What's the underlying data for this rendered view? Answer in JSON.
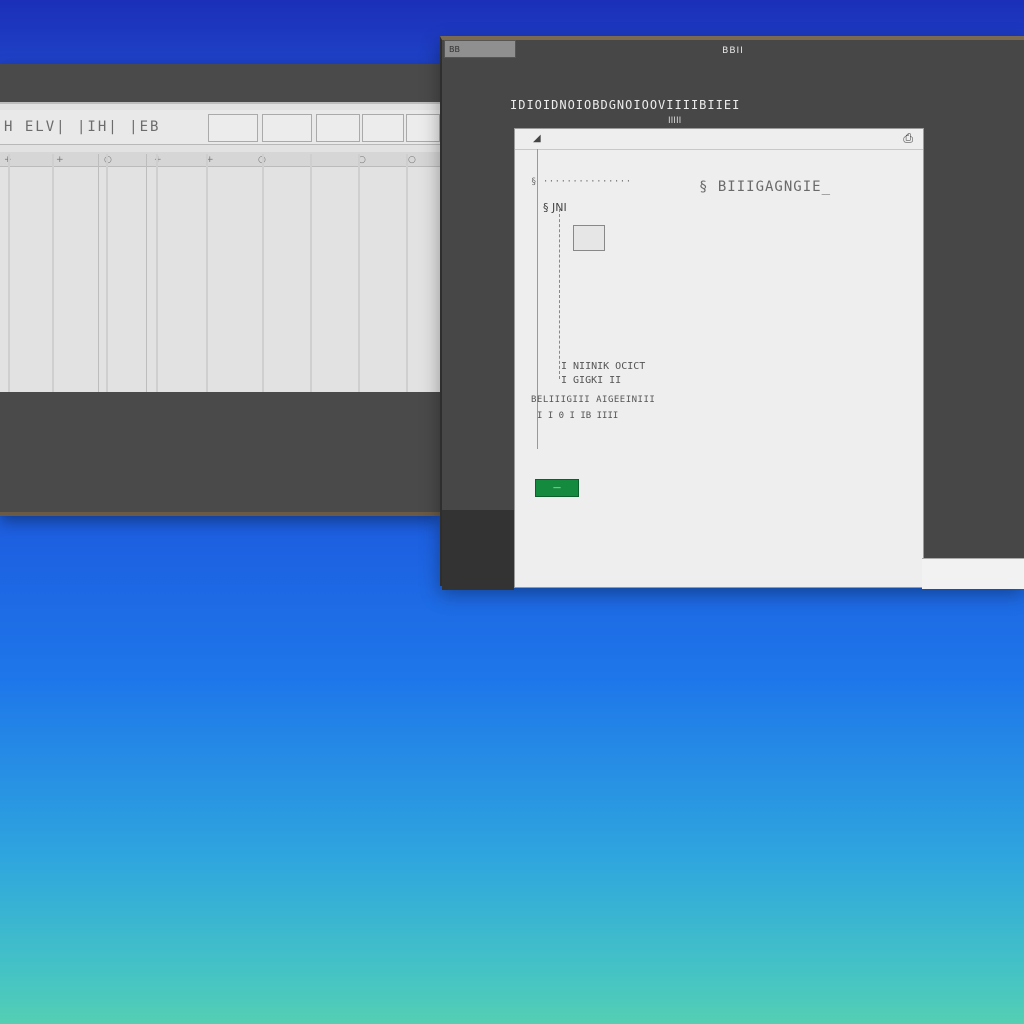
{
  "left_window": {
    "toolbar_label": "H  ELV|  |IH|  |EB",
    "column_markers": [
      "+",
      "+",
      "○",
      "+",
      "+",
      "○",
      "○",
      "○"
    ]
  },
  "right_window": {
    "title": "BBII",
    "tab_label": "BB",
    "heading": "IDIOIDNOIOBDGNOIOOVIIIIBIIEI",
    "heading_sub": "IIIII",
    "dialog": {
      "row1_small": "§ ···············",
      "row1_main": "§  BIIIGAGNGIE_",
      "row2": "§ JNI",
      "row3": "I NIINIK OCICT",
      "row4": "I GIGKI II",
      "row5": "BELIIIGIII  AIGEEINIII",
      "row6": "I I 0  I IB  IIII",
      "green_button": "—"
    }
  }
}
